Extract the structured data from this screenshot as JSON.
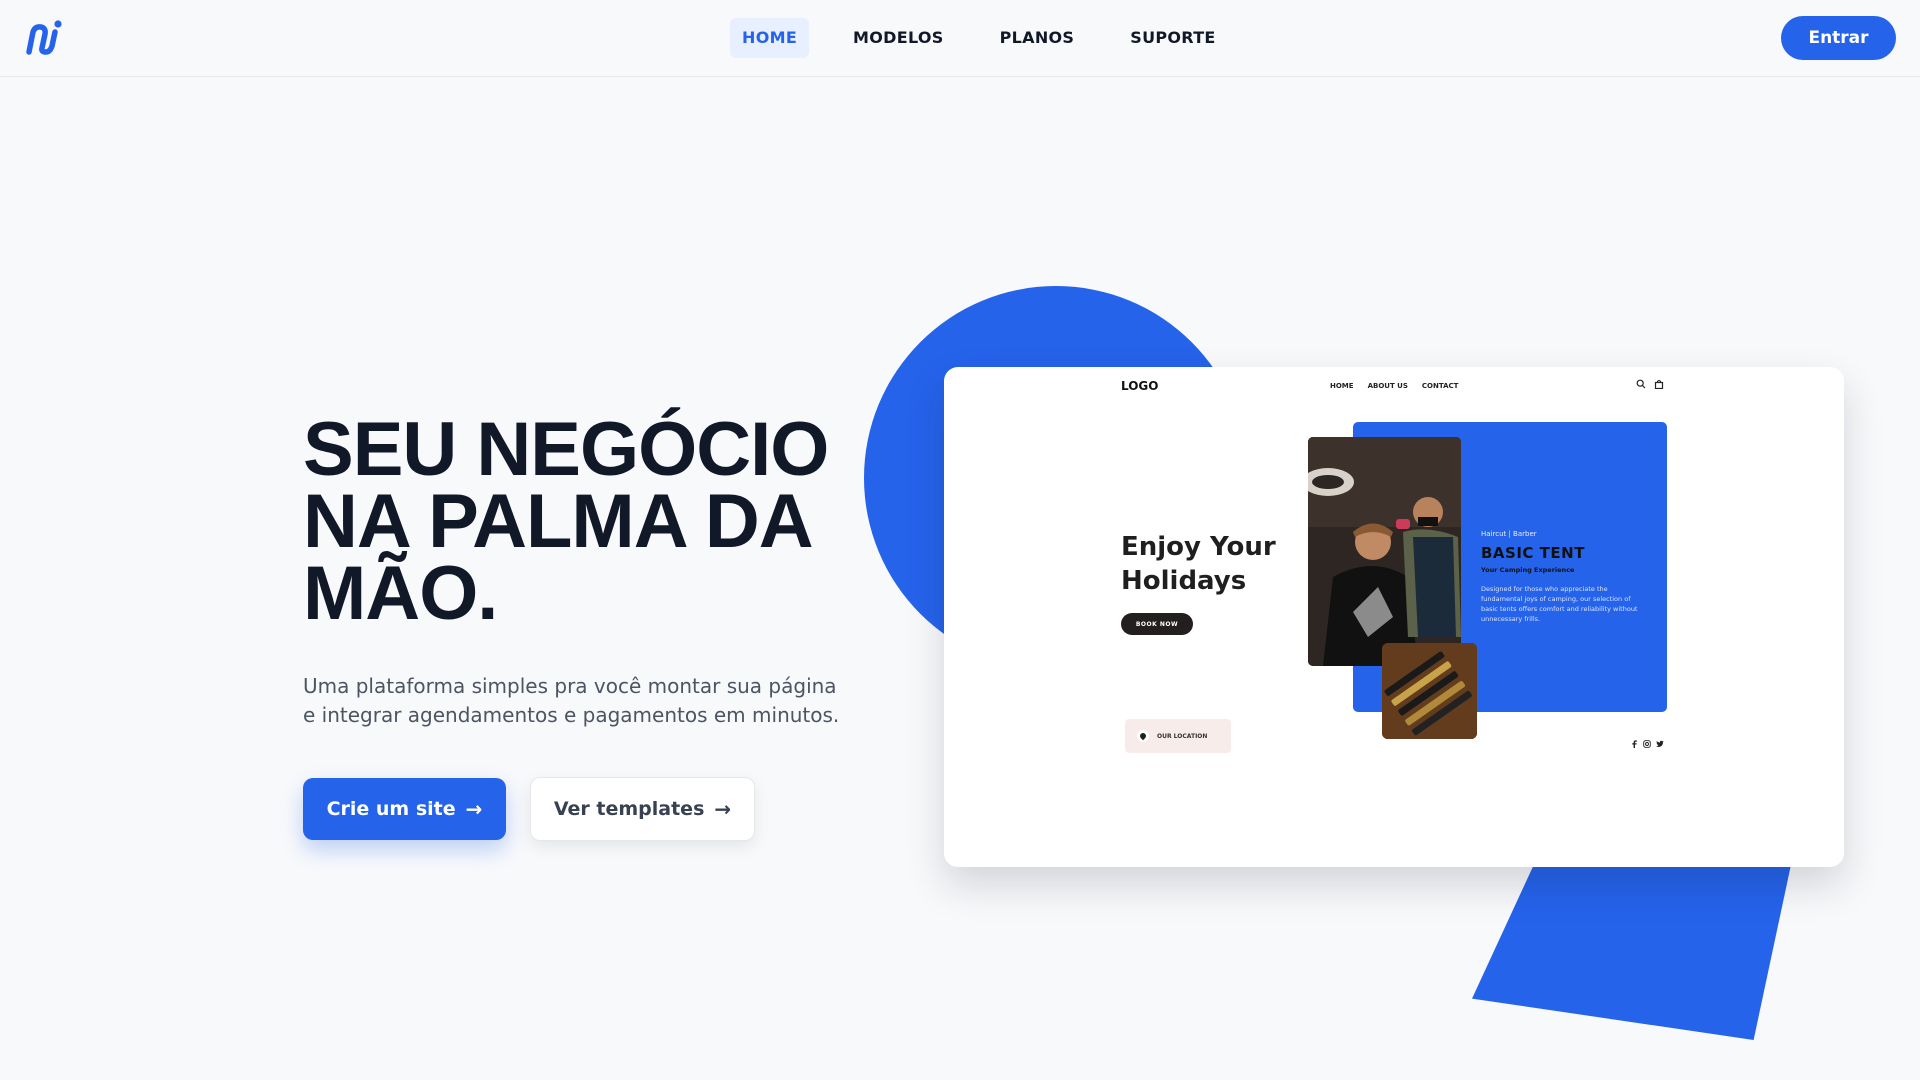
{
  "header": {
    "nav": [
      {
        "label": "HOME",
        "active": true
      },
      {
        "label": "MODELOS",
        "active": false
      },
      {
        "label": "PLANOS",
        "active": false
      },
      {
        "label": "SUPORTE",
        "active": false
      }
    ],
    "login_label": "Entrar"
  },
  "hero": {
    "title_lines": [
      "SEU NEGÓCIO",
      "NA PALMA DA",
      "MÃO."
    ],
    "subtitle": "Uma plataforma simples pra você montar sua página e integrar agendamentos e pagamentos em minutos.",
    "primary_button": "Crie um site",
    "secondary_button": "Ver templates",
    "arrow": "→"
  },
  "preview": {
    "logo": "LOGO",
    "nav": [
      "HOME",
      "ABOUT US",
      "CONTACT"
    ],
    "title": "Enjoy Your Holidays",
    "book_button": "BOOK NOW",
    "category": "Haircut | Barber",
    "heading": "BASIC TENT",
    "subheading": "Your Camping Experience",
    "description": "Designed for those who appreciate the fundamental joys of camping, our selection of basic tents offers comfort and reliability without unnecessary frills.",
    "location_label": "OUR LOCATION"
  },
  "colors": {
    "accent": "#2563eb",
    "text": "#111827",
    "background": "#f8f9fb"
  }
}
